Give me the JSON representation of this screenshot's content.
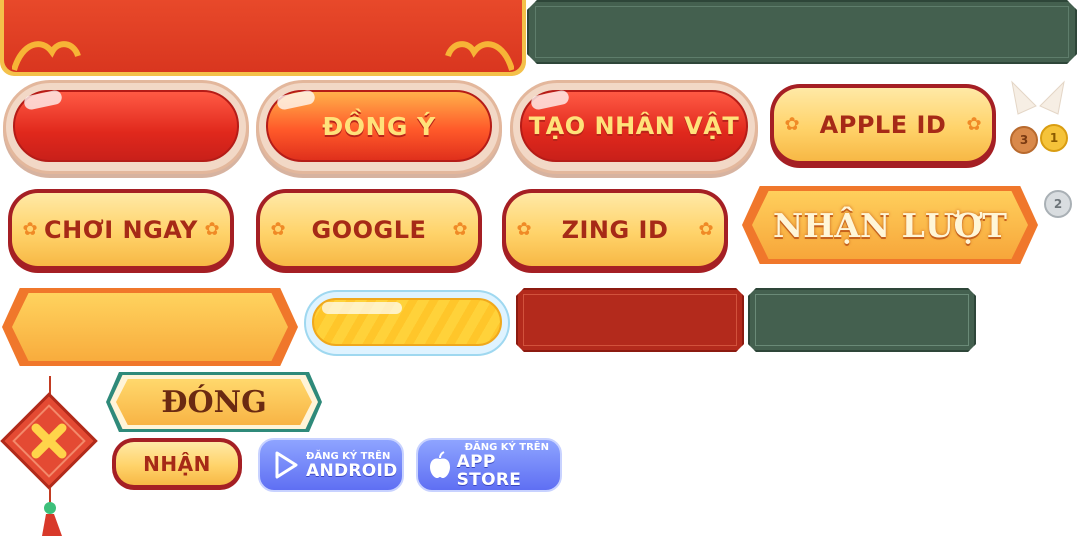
{
  "buttons": {
    "dong_y": "ĐỒNG Ý",
    "tao_nhan_vat": "TẠO NHÂN VẬT",
    "apple_id": "APPLE ID",
    "choi_ngay": "CHƠI NGAY",
    "google": "GOOGLE",
    "zing_id": "ZING ID",
    "nhan_luot": "NHẬN LƯỢT",
    "dong": "ĐÓNG",
    "nhan": "NHẬN"
  },
  "medals": {
    "bronze": "3",
    "gold": "1",
    "silver": "2"
  },
  "stores": {
    "android_small": "ĐĂNG KÝ TRÊN",
    "android_big": "ANDROID",
    "appstore_small": "ĐĂNG KÝ TRÊN",
    "appstore_big": "APP STORE"
  },
  "icons": [
    "close-x-icon",
    "play-store-icon",
    "apple-icon",
    "star-icon",
    "medal-icon"
  ],
  "colors": {
    "red": "#e0281c",
    "gold": "#ffd36a",
    "dark_green": "#44604f",
    "maroon": "#a51f24",
    "store_blue": "#6a7cf7"
  }
}
